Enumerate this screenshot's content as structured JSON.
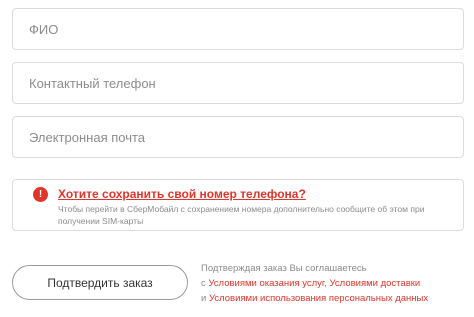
{
  "form": {
    "fio_placeholder": "ФИО",
    "phone_placeholder": "Контактный телефон",
    "email_placeholder": "Электронная почта"
  },
  "notice": {
    "icon": "exclamation-circle-icon",
    "icon_glyph": "!",
    "title": "Хотите сохранить свой номер телефона?",
    "text": "Чтобы перейти в СберМобайл с сохранением номера дополнительно сообщите об этом при получении SIM-карты"
  },
  "submit": {
    "button_label": "Подтвердить заказ"
  },
  "agreement": {
    "line1": "Подтверждая заказ Вы соглашаетесь",
    "prefix": "с ",
    "link_services": "Условиями оказания услуг",
    "sep1": ", ",
    "link_delivery": "Условиями доставки",
    "sep2": " и ",
    "link_personal_data": "Условиями использования персональных данных"
  },
  "colors": {
    "accent": "#e0352b",
    "border": "#dcdcdc",
    "muted_text": "#8c8c8c"
  }
}
